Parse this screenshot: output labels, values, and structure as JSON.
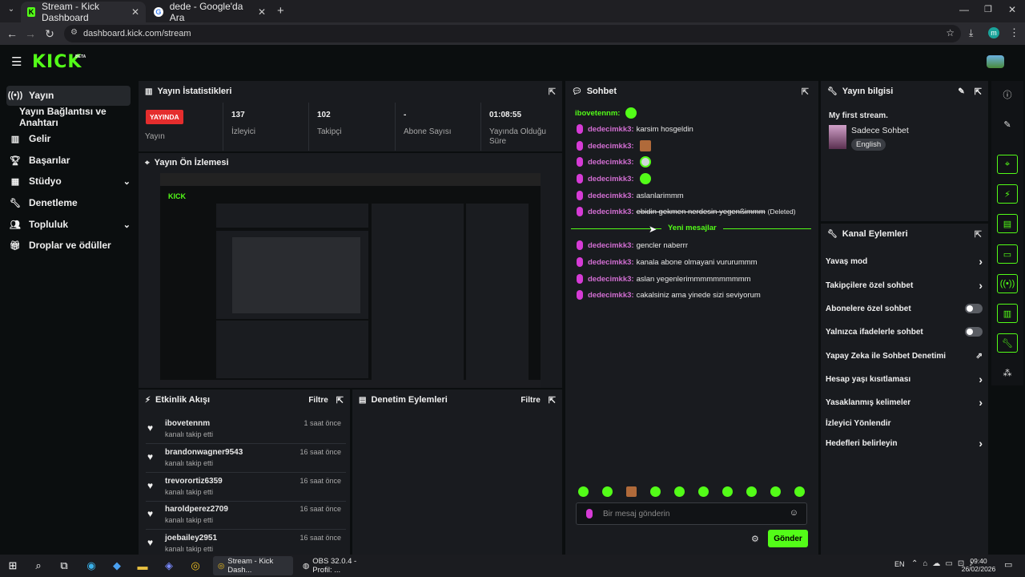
{
  "browser": {
    "tabs": [
      {
        "title": "Stream - Kick Dashboard",
        "active": true
      },
      {
        "title": "dede - Google'da Ara",
        "active": false
      }
    ],
    "url": "dashboard.kick.com/stream",
    "profile": "m"
  },
  "site": {
    "logo": "KICK",
    "logo_badge": "BETA"
  },
  "sidebar": {
    "items": [
      {
        "label": "Yayın",
        "icon": "broadcast-icon"
      },
      {
        "label": "Yayın Bağlantısı ve Anahtarı"
      },
      {
        "label": "Gelir",
        "icon": "chart-icon"
      },
      {
        "label": "Başarılar",
        "icon": "trophy-icon"
      },
      {
        "label": "Stüdyo",
        "icon": "studio-icon"
      },
      {
        "label": "Denetleme",
        "icon": "wrench-icon"
      },
      {
        "label": "Topluluk",
        "icon": "community-icon"
      },
      {
        "label": "Droplar ve ödüller",
        "icon": "gift-icon"
      }
    ]
  },
  "stats": {
    "title": "Yayın İstatistikleri",
    "badge": "YAYINDA",
    "badge_label": "Yayın",
    "items": [
      {
        "value": "137",
        "label": "İzleyici"
      },
      {
        "value": "102",
        "label": "Takipçi"
      },
      {
        "value": "-",
        "label": "Abone Sayısı"
      },
      {
        "value": "01:08:55",
        "label": "Yayında Olduğu Süre"
      }
    ]
  },
  "preview": {
    "title": "Yayın Ön İzlemesi"
  },
  "feed": {
    "title": "Etkinlik Akışı",
    "filter": "Filtre",
    "items": [
      {
        "name": "ibovetennm",
        "sub": "kanalı takip etti",
        "time": "1 saat önce"
      },
      {
        "name": "brandonwagner9543",
        "sub": "kanalı takip etti",
        "time": "16 saat önce"
      },
      {
        "name": "trevorortiz6359",
        "sub": "kanalı takip etti",
        "time": "16 saat önce"
      },
      {
        "name": "haroldperez2709",
        "sub": "kanalı takip etti",
        "time": "16 saat önce"
      },
      {
        "name": "joebailey2951",
        "sub": "kanalı takip etti",
        "time": "16 saat önce"
      }
    ]
  },
  "moderation": {
    "title": "Denetim Eylemleri",
    "filter": "Filtre"
  },
  "chat": {
    "title": "Sohbet",
    "first_user": "ibovetennm:",
    "messages": [
      {
        "user": "dedecimkk3:",
        "text": "karsim hosgeldin"
      },
      {
        "user": "dedecimkk3:",
        "text": ""
      },
      {
        "user": "dedecimkk3:",
        "text": ""
      },
      {
        "user": "dedecimkk3:",
        "text": ""
      },
      {
        "user": "dedecimkk3:",
        "text": "aslanlarimmm"
      },
      {
        "user": "dedecimkk3:",
        "text": "ebidin gekmen nerdesin yegenßimmm",
        "deleted": "(Deleted)"
      }
    ],
    "divider": "Yeni mesajlar",
    "messages2": [
      {
        "user": "dedecimkk3:",
        "text": "gencler naberrr"
      },
      {
        "user": "dedecimkk3:",
        "text": "kanala abone olmayani vururummm"
      },
      {
        "user": "dedecimkk3:",
        "text": "aslan yegenlerimmmmmmmmmm"
      },
      {
        "user": "dedecimkk3:",
        "text": "cakalsiniz ama yinede sizi seviyorum"
      }
    ],
    "placeholder": "Bir mesaj gönderin",
    "send": "Gönder"
  },
  "info": {
    "title": "Yayın bilgisi",
    "stream_title": "My first stream.",
    "category": "Sadece Sohbet",
    "language": "English"
  },
  "actions": {
    "title": "Kanal Eylemleri",
    "items": [
      {
        "label": "Yavaş mod",
        "ctrl": "chevron"
      },
      {
        "label": "Takipçilere özel sohbet",
        "ctrl": "chevron"
      },
      {
        "label": "Abonelere özel sohbet",
        "ctrl": "toggle"
      },
      {
        "label": "Yalnızca ifadelerle sohbet",
        "ctrl": "toggle"
      },
      {
        "label": "Yapay Zeka ile Sohbet Denetimi",
        "ctrl": "external"
      },
      {
        "label": "Hesap yaşı kısıtlaması",
        "ctrl": "chevron"
      },
      {
        "label": "Yasaklanmış kelimeler",
        "ctrl": "chevron"
      },
      {
        "label": "İzleyici Yönlendir",
        "ctrl": "none"
      },
      {
        "label": "Hedefleri belirleyin",
        "ctrl": "chevron"
      }
    ]
  },
  "taskbar": {
    "apps": [
      {
        "label": "Stream - Kick Dash..."
      },
      {
        "label": "OBS 32.0.4 - Profil: ..."
      }
    ],
    "lang": "EN",
    "time": "09:40",
    "date": "26/02/2026"
  }
}
